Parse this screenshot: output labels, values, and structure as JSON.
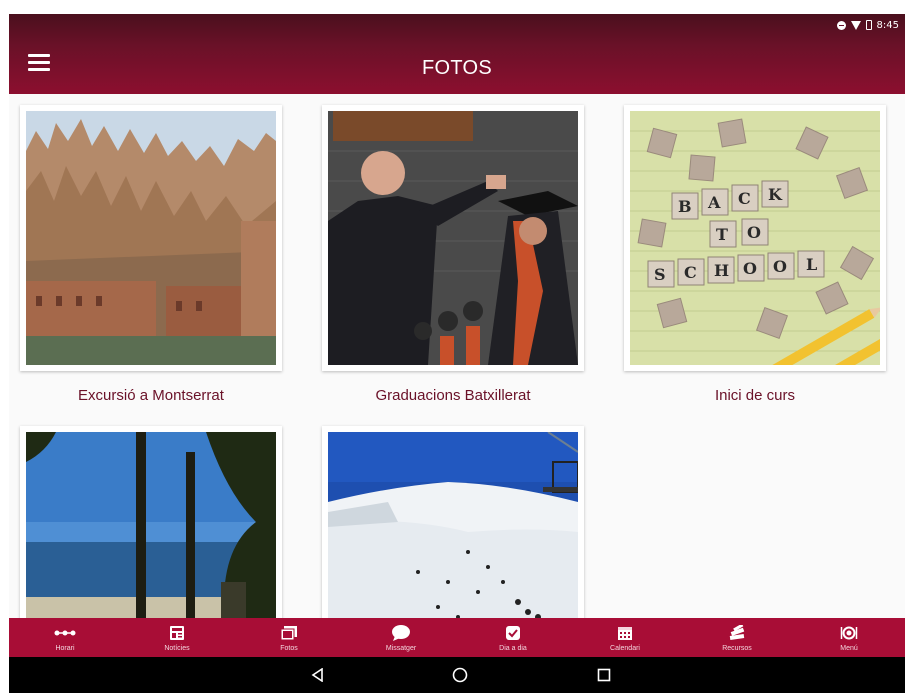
{
  "status_bar": {
    "time": "8:45"
  },
  "app_bar": {
    "title": "FOTOS"
  },
  "albums": [
    {
      "caption": "Excursió a Montserrat"
    },
    {
      "caption": "Graduacions Batxillerat"
    },
    {
      "caption": "Inici de curs"
    },
    {
      "caption": ""
    },
    {
      "caption": ""
    }
  ],
  "scrabble_tiles": [
    "B",
    "A",
    "C",
    "K",
    "T",
    "O",
    "S",
    "C",
    "H",
    "O",
    "O",
    "L"
  ],
  "bottom_nav": [
    {
      "label": "Horari",
      "icon": "dots-line-icon"
    },
    {
      "label": "Notícies",
      "icon": "news-icon"
    },
    {
      "label": "Fotos",
      "icon": "photos-icon"
    },
    {
      "label": "Missatger",
      "icon": "chat-bubble-icon"
    },
    {
      "label": "Dia a dia",
      "icon": "check-square-icon"
    },
    {
      "label": "Calendari",
      "icon": "calendar-icon"
    },
    {
      "label": "Recursos",
      "icon": "books-icon"
    },
    {
      "label": "Menú",
      "icon": "dish-icon"
    }
  ],
  "colors": {
    "appbar": "#6a1128",
    "navbar": "#a80d36",
    "caption": "#6a1128"
  }
}
